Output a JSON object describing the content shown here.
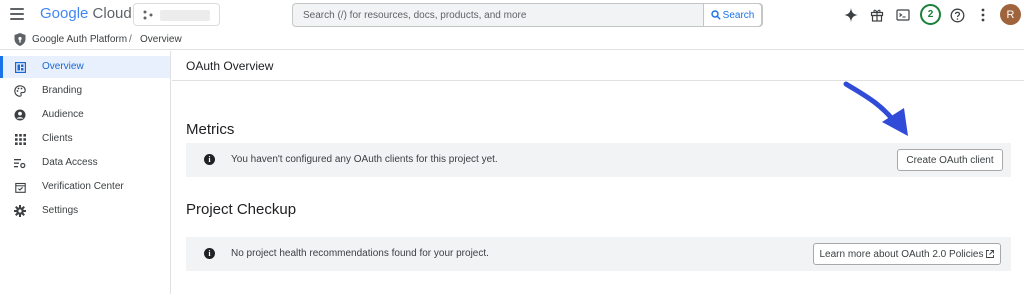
{
  "app": {
    "logo_google": "Google",
    "logo_cloud": "Cloud"
  },
  "search": {
    "placeholder": "Search (/) for resources, docs, products, and more",
    "button_label": "Search"
  },
  "header": {
    "notification_count": "2",
    "avatar_initial": "R"
  },
  "breadcrumb": {
    "product": "Google Auth Platform",
    "separator": "/",
    "current": "Overview"
  },
  "sidebar": {
    "items": [
      {
        "label": "Overview",
        "icon": "dashboard-icon",
        "active": true
      },
      {
        "label": "Branding",
        "icon": "palette-icon"
      },
      {
        "label": "Audience",
        "icon": "person-circle-icon"
      },
      {
        "label": "Clients",
        "icon": "apps-grid-icon"
      },
      {
        "label": "Data Access",
        "icon": "data-access-icon"
      },
      {
        "label": "Verification Center",
        "icon": "verified-calendar-icon"
      },
      {
        "label": "Settings",
        "icon": "gear-icon"
      }
    ]
  },
  "main": {
    "page_title": "OAuth Overview",
    "metrics": {
      "title": "Metrics",
      "message": "You haven't configured any OAuth clients for this project yet.",
      "button_label": "Create OAuth client"
    },
    "checkup": {
      "title": "Project Checkup",
      "message": "No project health recommendations found for your project.",
      "button_label": "Learn more about OAuth 2.0 Policies"
    }
  },
  "colors": {
    "accent": "#1a73e8",
    "active_bg": "#e8f0fe",
    "notice_bg": "#f1f3f4",
    "badge_green": "#188038",
    "annotation_arrow": "#2f4bd8"
  }
}
